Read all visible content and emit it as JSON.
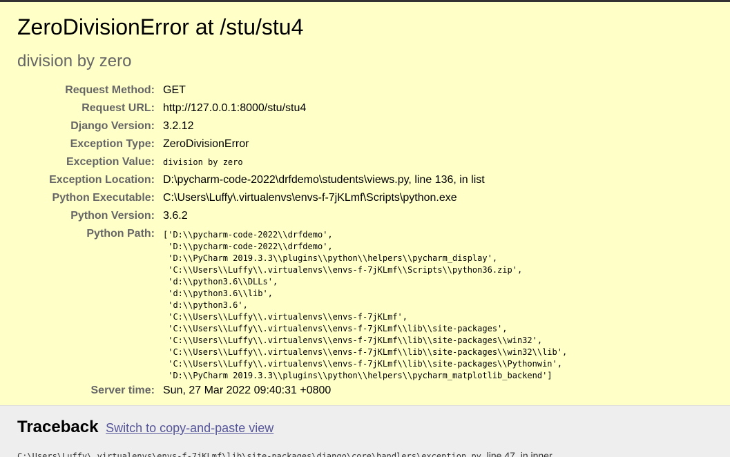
{
  "error": {
    "title": "ZeroDivisionError at /stu/stu4",
    "subtitle": "division by zero"
  },
  "meta": {
    "request_method_label": "Request Method:",
    "request_method": "GET",
    "request_url_label": "Request URL:",
    "request_url": "http://127.0.0.1:8000/stu/stu4",
    "django_version_label": "Django Version:",
    "django_version": "3.2.12",
    "exception_type_label": "Exception Type:",
    "exception_type": "ZeroDivisionError",
    "exception_value_label": "Exception Value:",
    "exception_value": "division by zero",
    "exception_location_label": "Exception Location:",
    "exception_location": "D:\\pycharm-code-2022\\drfdemo\\students\\views.py, line 136, in list",
    "python_executable_label": "Python Executable:",
    "python_executable": "C:\\Users\\Luffy\\.virtualenvs\\envs-f-7jKLmf\\Scripts\\python.exe",
    "python_version_label": "Python Version:",
    "python_version": "3.6.2",
    "python_path_label": "Python Path:",
    "python_path": "['D:\\\\pycharm-code-2022\\\\drfdemo',\n 'D:\\\\pycharm-code-2022\\\\drfdemo',\n 'D:\\\\PyCharm 2019.3.3\\\\plugins\\\\python\\\\helpers\\\\pycharm_display',\n 'C:\\\\Users\\\\Luffy\\\\.virtualenvs\\\\envs-f-7jKLmf\\\\Scripts\\\\python36.zip',\n 'd:\\\\python3.6\\\\DLLs',\n 'd:\\\\python3.6\\\\lib',\n 'd:\\\\python3.6',\n 'C:\\\\Users\\\\Luffy\\\\.virtualenvs\\\\envs-f-7jKLmf',\n 'C:\\\\Users\\\\Luffy\\\\.virtualenvs\\\\envs-f-7jKLmf\\\\lib\\\\site-packages',\n 'C:\\\\Users\\\\Luffy\\\\.virtualenvs\\\\envs-f-7jKLmf\\\\lib\\\\site-packages\\\\win32',\n 'C:\\\\Users\\\\Luffy\\\\.virtualenvs\\\\envs-f-7jKLmf\\\\lib\\\\site-packages\\\\win32\\\\lib',\n 'C:\\\\Users\\\\Luffy\\\\.virtualenvs\\\\envs-f-7jKLmf\\\\lib\\\\site-packages\\\\Pythonwin',\n 'D:\\\\PyCharm 2019.3.3\\\\plugins\\\\python\\\\helpers\\\\pycharm_matplotlib_backend']",
    "server_time_label": "Server time:",
    "server_time": "Sun, 27 Mar 2022 09:40:31 +0800"
  },
  "traceback": {
    "heading": "Traceback",
    "switch_link": "Switch to copy-and-paste view",
    "first_frame_path": "C:\\Users\\Luffy\\.virtualenvs\\envs-f-7jKLmf\\lib\\site-packages\\django\\core\\handlers\\exception.py",
    "first_frame_suffix": ", line 47, in inner"
  },
  "colors": {
    "summary_bg": "#ffffc8",
    "traceback_bg": "#eeeeee",
    "label": "#666666",
    "link": "#555599"
  }
}
